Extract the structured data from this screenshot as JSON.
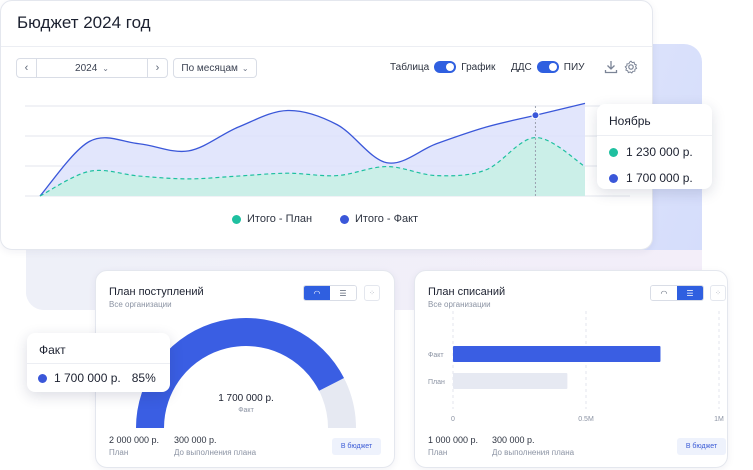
{
  "main": {
    "title": "Бюджет 2024 год",
    "year": "2024",
    "period": "По месяцам",
    "toggle_table": "Таблица",
    "toggle_chart": "График",
    "toggle_dds": "ДДС",
    "toggle_piu": "ПИУ",
    "legend_plan": "Итого - План",
    "legend_fact": "Итого - Факт"
  },
  "tooltip": {
    "month": "Ноябрь",
    "plan_value": "1 230 000 р.",
    "fact_value": "1 700 000 р."
  },
  "income": {
    "title": "План поступлений",
    "caption": "Все организации",
    "center_value": "1 700 000 р.",
    "center_label": "Факт",
    "plan_value": "2 000 000 р.",
    "plan_label": "План",
    "remaining_value": "300 000 р.",
    "remaining_label": "До выполнения плана",
    "budget_button": "В бюджет",
    "progress_pct": 85
  },
  "expense": {
    "title": "План списаний",
    "caption": "Все организации",
    "bar_fact_label": "Факт",
    "bar_plan_label": "План",
    "plan_value": "1 000 000 р.",
    "plan_label": "План",
    "remaining_value": "300 000 р.",
    "remaining_label": "До выполнения плана",
    "budget_button": "В бюджет"
  },
  "fact_popup": {
    "title": "Факт",
    "value": "1 700 000 р.",
    "percent": "85%"
  },
  "colors": {
    "accent": "#2f5fe0",
    "plan": "#1fc0a0",
    "fact": "#3a57d9",
    "gauge_track": "#e6e9f2"
  },
  "icons": [
    "chevron-left-icon",
    "chevron-right-icon",
    "chevron-down-icon",
    "download-icon",
    "gear-icon",
    "arc-chart-icon",
    "bar-list-icon",
    "expand-icon"
  ],
  "chart_data": [
    {
      "type": "area",
      "title": "",
      "series": [
        {
          "name": "Итого - Факт",
          "values": [
            0,
            1150000,
            1100000,
            950000,
            1450000,
            1800000,
            1500000,
            700000,
            1100000,
            1450000,
            1700000,
            1950000
          ]
        },
        {
          "name": "Итого - План",
          "values": [
            0,
            520000,
            420000,
            360000,
            420000,
            480000,
            430000,
            620000,
            430000,
            550000,
            1230000,
            620000
          ]
        }
      ],
      "grid": true
    },
    {
      "type": "bar",
      "title": "План списаний",
      "categories": [
        "Факт",
        "План"
      ],
      "values": [
        780000,
        430000
      ],
      "x_ticks": [
        "0",
        "0.5M",
        "1M"
      ],
      "xlim": [
        0,
        1000000
      ]
    }
  ]
}
